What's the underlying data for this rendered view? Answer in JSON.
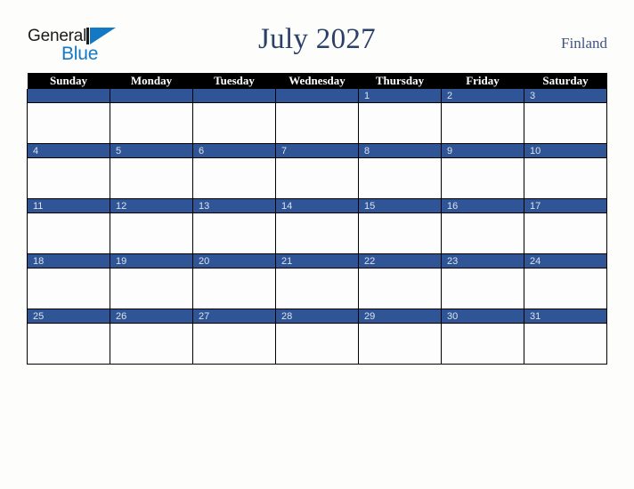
{
  "brand": {
    "word_one": "General",
    "word_two": "Blue",
    "triangle_color": "#1479c4",
    "text_color": "#1c1c1c"
  },
  "header": {
    "title": "July 2027",
    "locale": "Finland",
    "title_color": "#2b4066",
    "locale_color": "#3f5580"
  },
  "calendar": {
    "accent_color": "#2f5597",
    "header_bg": "#000000",
    "header_text_color": "#ffffff",
    "daynum_text_color": "#dde2ea",
    "weekday_headers": [
      "Sunday",
      "Monday",
      "Tuesday",
      "Wednesday",
      "Thursday",
      "Friday",
      "Saturday"
    ],
    "weeks": [
      [
        "",
        "",
        "",
        "",
        "1",
        "2",
        "3"
      ],
      [
        "4",
        "5",
        "6",
        "7",
        "8",
        "9",
        "10"
      ],
      [
        "11",
        "12",
        "13",
        "14",
        "15",
        "16",
        "17"
      ],
      [
        "18",
        "19",
        "20",
        "21",
        "22",
        "23",
        "24"
      ],
      [
        "25",
        "26",
        "27",
        "28",
        "29",
        "30",
        "31"
      ]
    ]
  }
}
